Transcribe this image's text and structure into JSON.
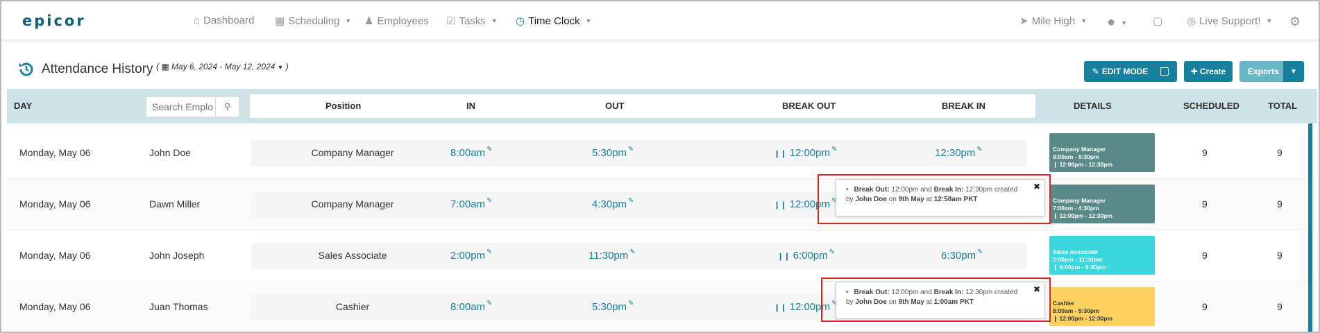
{
  "brand": {
    "logo": "epicor",
    "accent": "#17819c",
    "details_colors": {
      "manager": "#5a8a88",
      "associate": "#3ad8de",
      "cashier": "#fdd062"
    }
  },
  "nav": {
    "items": [
      {
        "label": "Dashboard",
        "icon": "home-icon"
      },
      {
        "label": "Scheduling",
        "icon": "calendar-icon"
      },
      {
        "label": "Employees",
        "icon": "users-icon"
      },
      {
        "label": "Tasks",
        "icon": "checkbox-icon"
      },
      {
        "label": "Time Clock",
        "icon": "clock-icon"
      }
    ],
    "location": "Mile High",
    "support": "Live Support!"
  },
  "page": {
    "title": "Attendance History",
    "date_range": "May 6, 2024 - May 12, 2024",
    "edit_mode": "EDIT MODE",
    "create": "Create",
    "exports": "Exports"
  },
  "table": {
    "headers": {
      "day": "DAY",
      "position": "Position",
      "in": "IN",
      "out": "OUT",
      "break_out": "BREAK OUT",
      "break_in": "BREAK IN",
      "details": "DETAILS",
      "scheduled": "SCHEDULED",
      "total": "TOTAL"
    },
    "search_placeholder": "Search Employee",
    "rows": [
      {
        "day": "Monday, May 06",
        "name": "John Doe",
        "position": "Company Manager",
        "in": "8:00am",
        "out": "5:30pm",
        "break_out": "12:00pm",
        "break_in": "12:30pm",
        "details": {
          "title": "Company Manager",
          "shift": "8:00am - 5:30pm",
          "break": "12:00pm - 12:30pm"
        },
        "scheduled": "9",
        "total": "9"
      },
      {
        "day": "Monday, May 06",
        "name": "Dawn Miller",
        "position": "Company Manager",
        "in": "7:00am",
        "out": "4:30pm",
        "break_out": "12:00pm",
        "break_in": "",
        "details": {
          "title": "Company Manager",
          "shift": "7:00am - 4:30pm",
          "break": "12:00pm - 12:30pm"
        },
        "scheduled": "9",
        "total": "9"
      },
      {
        "day": "Monday, May 06",
        "name": "John Joseph",
        "position": "Sales Associate",
        "in": "2:00pm",
        "out": "11:30pm",
        "break_out": "6:00pm",
        "break_in": "6:30pm",
        "details": {
          "title": "Sales Associate",
          "shift": "2:00pm - 11:30pm",
          "break": "6:00pm - 6:30pm"
        },
        "scheduled": "9",
        "total": "9"
      },
      {
        "day": "Monday, May 06",
        "name": "Juan Thomas",
        "position": "Cashier",
        "in": "8:00am",
        "out": "5:30pm",
        "break_out": "12:00pm",
        "break_in": "",
        "details": {
          "title": "Cashier",
          "shift": "8:00am - 5:30pm",
          "break": "12:00pm - 12:30pm"
        },
        "scheduled": "9",
        "total": "9"
      }
    ]
  },
  "popovers": [
    {
      "bo_label": "Break Out:",
      "bo_time": "12:00pm",
      "and": "and",
      "bi_label": "Break In:",
      "bi_time": "12:30pm",
      "created": "created",
      "by": "by",
      "user": "John Doe",
      "on": "on",
      "date": "9th May",
      "at": "at",
      "time": "12:58am PKT"
    },
    {
      "bo_label": "Break Out:",
      "bo_time": "12:00pm",
      "and": "and",
      "bi_label": "Break In:",
      "bi_time": "12:30pm",
      "created": "created",
      "by": "by",
      "user": "John Doe",
      "on": "on",
      "date": "9th May",
      "at": "at",
      "time": "1:00am PKT"
    }
  ]
}
